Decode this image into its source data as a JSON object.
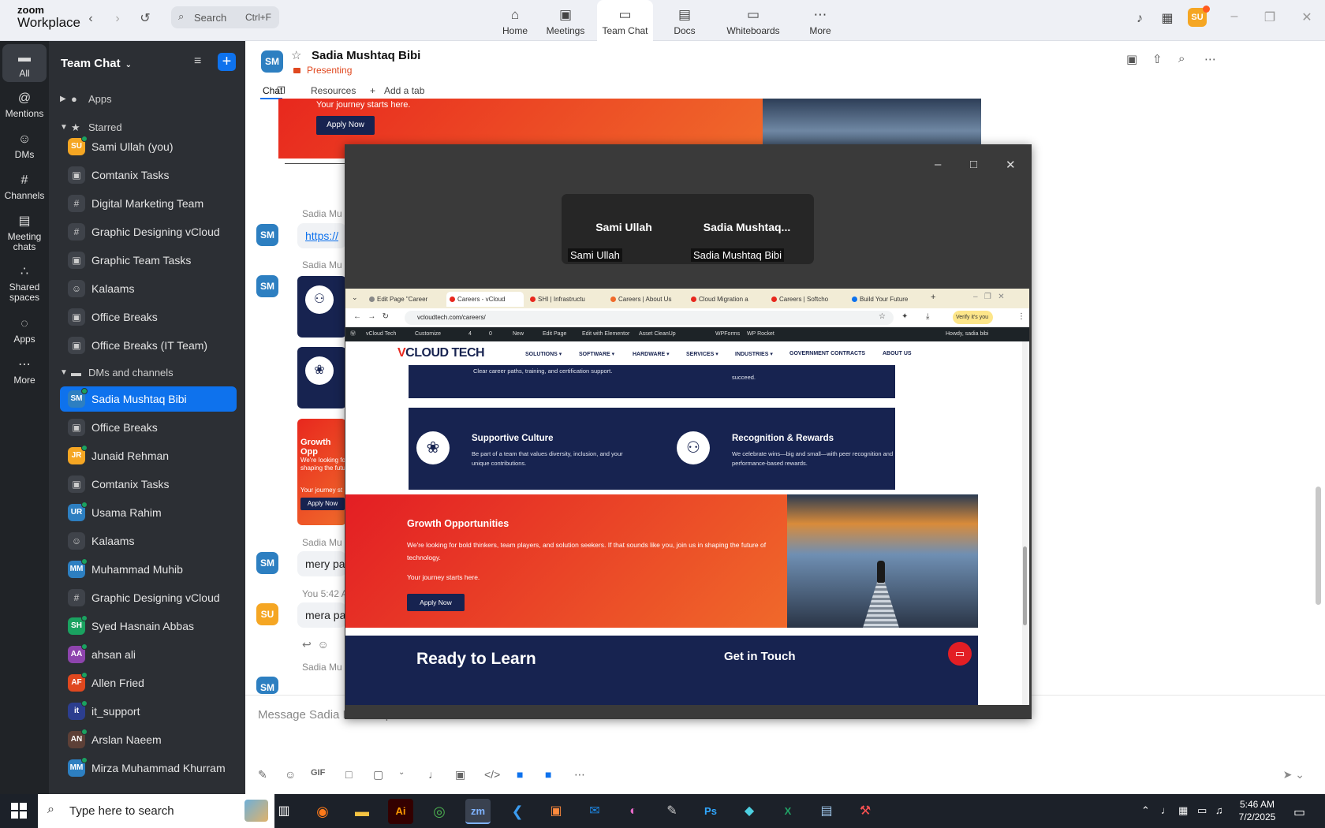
{
  "app": {
    "logo_line1": "zoom",
    "logo_line2": "Workplace",
    "search_placeholder": "Search",
    "search_shortcut": "Ctrl+F",
    "user_initials": "SU",
    "accent": "#0e72ed"
  },
  "nav_tabs": [
    {
      "label": "Home",
      "icon": "home-icon"
    },
    {
      "label": "Meetings",
      "icon": "video-camera-icon"
    },
    {
      "label": "Team Chat",
      "icon": "chat-icon"
    },
    {
      "label": "Docs",
      "icon": "document-icon"
    },
    {
      "label": "Whiteboards",
      "icon": "whiteboard-icon"
    },
    {
      "label": "More",
      "icon": "more-icon"
    }
  ],
  "rail": [
    {
      "label": "All",
      "icon": "chat-icon"
    },
    {
      "label": "Mentions",
      "icon": "at-icon"
    },
    {
      "label": "DMs",
      "icon": "people-icon"
    },
    {
      "label": "Channels",
      "icon": "hash-icon"
    },
    {
      "label": "Meeting chats",
      "icon": "calendar-icon"
    },
    {
      "label": "Shared spaces",
      "icon": "shared-spaces-icon"
    },
    {
      "label": "Apps",
      "icon": "apps-icon"
    },
    {
      "label": "More",
      "icon": "more-icon"
    }
  ],
  "sidebar": {
    "title": "Team Chat",
    "sections": {
      "apps": "Apps",
      "starred": "Starred",
      "dms": "DMs and channels"
    },
    "starred": [
      {
        "label": "Sami Ullah (you)",
        "initials": "SU",
        "color": "#f5a623",
        "kind": "avatar"
      },
      {
        "label": "Comtanix Tasks",
        "kind": "lock"
      },
      {
        "label": "Digital Marketing Team",
        "kind": "hash"
      },
      {
        "label": "Graphic Designing vCloud",
        "kind": "hash"
      },
      {
        "label": "Graphic Team Tasks",
        "kind": "lock"
      },
      {
        "label": "Kalaams",
        "kind": "group"
      },
      {
        "label": "Office Breaks",
        "kind": "lock"
      },
      {
        "label": "Office Breaks (IT Team)",
        "kind": "lock"
      }
    ],
    "dms": [
      {
        "label": "Sadia Mushtaq Bibi",
        "initials": "SM",
        "color": "#2d7fc1",
        "kind": "avatar",
        "active": true
      },
      {
        "label": "Office Breaks",
        "kind": "lock"
      },
      {
        "label": "Junaid Rehman",
        "initials": "JR",
        "color": "#f5a623",
        "kind": "avatar"
      },
      {
        "label": "Comtanix Tasks",
        "kind": "lock"
      },
      {
        "label": "Usama Rahim",
        "initials": "UR",
        "color": "#2d7fc1",
        "kind": "avatar"
      },
      {
        "label": "Kalaams",
        "kind": "group"
      },
      {
        "label": "Muhammad Muhib",
        "initials": "MM",
        "color": "#2d7fc1",
        "kind": "avatar"
      },
      {
        "label": "Graphic Designing vCloud",
        "kind": "hash"
      },
      {
        "label": "Syed Hasnain Abbas",
        "initials": "SH",
        "color": "#1aa260",
        "kind": "avatar"
      },
      {
        "label": "ahsan ali",
        "initials": "AA",
        "color": "#8e44ad",
        "kind": "avatar"
      },
      {
        "label": "Allen Fried",
        "initials": "AF",
        "color": "#e0481f",
        "kind": "avatar"
      },
      {
        "label": "it_support",
        "initials": "it",
        "color": "#2c3e8f",
        "kind": "avatar"
      },
      {
        "label": "Arslan Naeem",
        "initials": "AN",
        "color": "#5d4037",
        "kind": "avatar"
      },
      {
        "label": "Mirza Muhammad Khurram",
        "initials": "MM",
        "color": "#2d7fc1",
        "kind": "avatar"
      }
    ]
  },
  "chat": {
    "initials": "SM",
    "name": "Sadia Mushtaq Bibi",
    "status": "Presenting",
    "tabs": [
      "Chat",
      "Resources",
      "Add a tab"
    ],
    "banner_journey": "Your journey starts here.",
    "banner_apply": "Apply Now",
    "messages": [
      {
        "sender": "Sadia Mu",
        "initials": "SM",
        "text": "https://"
      },
      {
        "sender": "Sadia Mu",
        "initials": "SM"
      },
      {
        "sender": "Sadia Mu",
        "initials": "SM",
        "text": "mery pa"
      },
      {
        "sender": "You 5:42 A",
        "initials": "SU",
        "text": "mera pa"
      },
      {
        "sender": "Sadia Mu",
        "initials": "SM"
      }
    ],
    "card_title": "Growth Opp",
    "card_sub": "We're looking fo shaping the futu",
    "card_journey": "Your journey st",
    "card_btn": "Apply Now",
    "composer_placeholder": "Message Sadia Mushtaq Bibi"
  },
  "share": {
    "gallery": [
      {
        "big": "Sami Ullah",
        "tag": "Sami Ullah"
      },
      {
        "big": "Sadia  Mushtaq...",
        "tag": "Sadia Mushtaq Bibi"
      }
    ],
    "browser": {
      "tabs": [
        "Edit Page \"Career",
        "Careers - vCloud",
        "SHI | Infrastructu",
        "Careers | About Us",
        "Cloud Migration a",
        "Careers | Softcho",
        "Build Your Future"
      ],
      "url": "vcloudtech.com/careers/",
      "verify": "Verify it's you",
      "wp_bar": [
        "vCloud Tech",
        "Customize",
        "4",
        "0",
        "New",
        "Edit Page",
        "Edit with Elementor",
        "Asset CleanUp",
        "WPForms",
        "WP Rocket"
      ],
      "wp_howdy": "Howdy, sadia bibi"
    },
    "site": {
      "logo_v": "V",
      "logo_rest": "CLOUD TECH",
      "menu": [
        "SOLUTIONS ▾",
        "SOFTWARE ▾",
        "HARDWARE ▾",
        "SERVICES ▾",
        "INDUSTRIES ▾",
        "GOVERNMENT CONTRACTS",
        "ABOUT US"
      ],
      "top_partial_text": "Clear career paths, training, and certification support.",
      "top_partial_text2": "succeed.",
      "feature1_title": "Supportive Culture",
      "feature1_desc": "Be part of a team that values diversity, inclusion, and your unique contributions.",
      "feature2_title": "Recognition & Rewards",
      "feature2_desc": "We celebrate wins—big and small—with peer recognition and performance-based rewards.",
      "hero_title": "Growth Opportunities",
      "hero_desc": "We're looking for bold thinkers, team players, and solution seekers. If that sounds like you, join us in shaping the future of technology.",
      "hero_journey": "Your journey starts here.",
      "hero_button": "Apply Now",
      "footer_left": "Ready to Learn",
      "footer_right": "Get in Touch"
    }
  },
  "taskbar": {
    "search_placeholder": "Type here to search",
    "apps": [
      "Task View",
      "Firefox",
      "File Explorer",
      "Illustrator",
      "Chrome",
      "Zoom",
      "VS Code",
      "App",
      "Outlook",
      "Photo App",
      "Pen Tool",
      "Photoshop",
      "App",
      "Excel",
      "Notepad",
      "App"
    ],
    "time": "5:46 AM",
    "date": "7/2/2025"
  }
}
